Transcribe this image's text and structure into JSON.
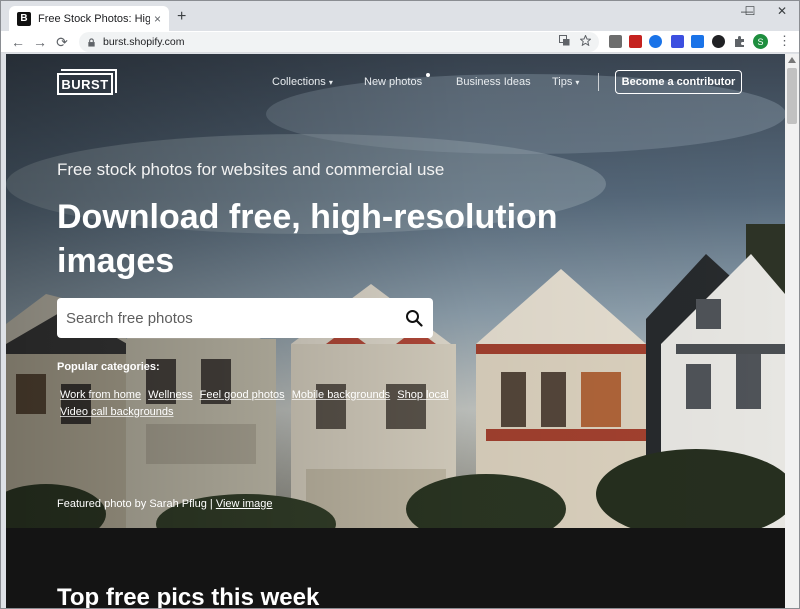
{
  "browser": {
    "tab_favicon": "B",
    "tab_title": "Free Stock Photos: High-Res Ima",
    "tab_close": "×",
    "new_tab": "+",
    "minimize": "—",
    "maximize": "☐",
    "close": "✕",
    "back": "←",
    "forward": "→",
    "reload": "⟳",
    "url": "burst.shopify.com",
    "profile_initial": "S",
    "menu": "⋮",
    "extension_colors": [
      "#6d6d6d",
      "#c5221f",
      "#1a73e8",
      "#3c4fe0",
      "#1a73e8",
      "#202124",
      "#5f6368"
    ]
  },
  "site": {
    "logo_text": "BURST",
    "nav": {
      "collections": "Collections",
      "new_photos": "New photos",
      "business_ideas": "Business Ideas",
      "tips": "Tips",
      "caret": "▾"
    },
    "contributor_button": "Become a contributor",
    "subtitle": "Free stock photos for websites and commercial use",
    "headline": "Download free, high-resolution images",
    "search": {
      "placeholder": "Search free photos"
    },
    "popular_label": "Popular categories:",
    "categories": [
      "Work from home",
      "Wellness",
      "Feel good photos",
      "Mobile backgrounds",
      "Shop local",
      "Video call backgrounds"
    ],
    "credit_prefix": "Featured photo by Sarah Pflug |",
    "credit_link": "View image",
    "section_title": "Top free pics this week"
  }
}
